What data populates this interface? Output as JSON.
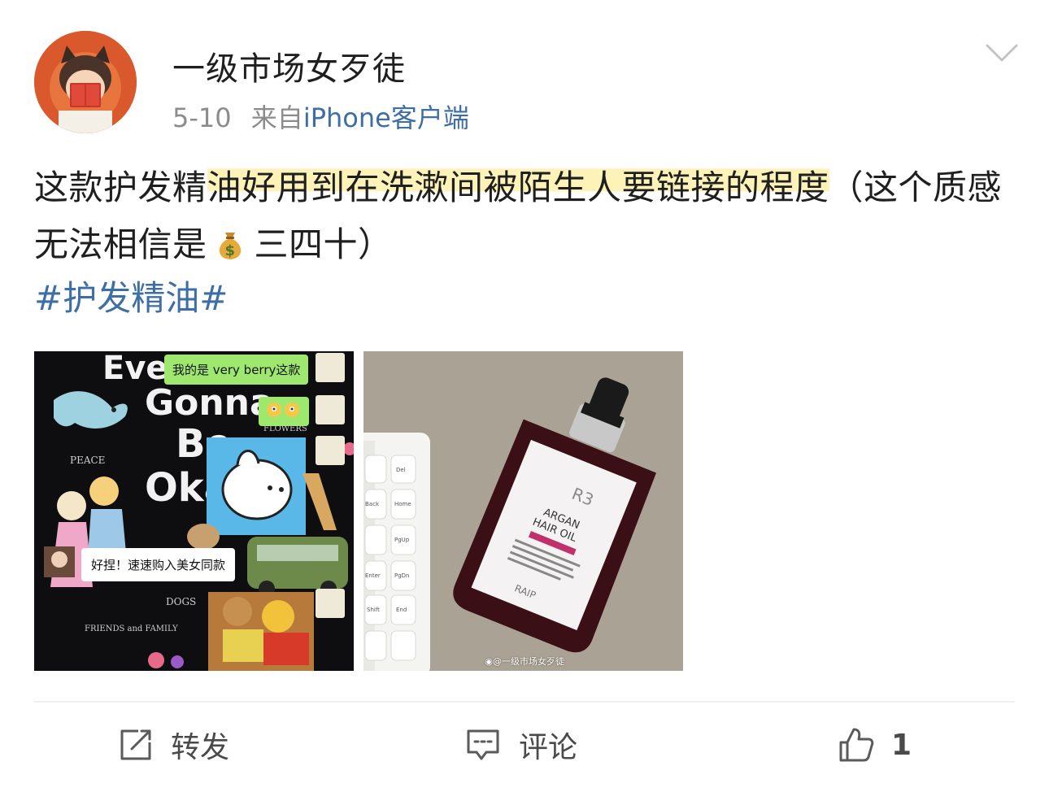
{
  "post": {
    "username": "一级市场女歹徒",
    "date": "5-10",
    "source_prefix": "来自",
    "device": "iPhone客户端",
    "text_before": "这款护发精",
    "text_highlight": "油好用到在洗漱间被陌生人要链接的程度",
    "text_after": "（这个质感 无法相信是",
    "text_end": "三四十）",
    "money_emoji_icon": "money-bag-icon",
    "hashtag": "#护发精油#"
  },
  "images": {
    "image1": {
      "bubble_top": "我的是 very berry这款",
      "bubble_bottom": "好捏！速速购入美女同款",
      "poster_words": [
        "Ever",
        "Gonna",
        "Be",
        "Oka"
      ],
      "labels": [
        "PEACE",
        "FLOWERS",
        "DOGS",
        "FRIENDS and FAMILY"
      ]
    },
    "image2": {
      "product_brand": "R3",
      "product_name_line1": "ARGAN",
      "product_name_line2": "HAIR OIL",
      "product_maker": "RAIP",
      "keys": [
        "Del",
        "Home",
        "PgUp",
        "PgDn",
        "End",
        "Back",
        "Enter",
        "Shift"
      ],
      "watermark": "@一级市场女歹徒"
    }
  },
  "actions": {
    "repost_label": "转发",
    "comment_label": "评论",
    "like_count": "1"
  },
  "colors": {
    "link_blue": "#3d6fa6",
    "highlight_yellow": "#fdf2b8",
    "meta_gray": "#8c8c8c"
  }
}
